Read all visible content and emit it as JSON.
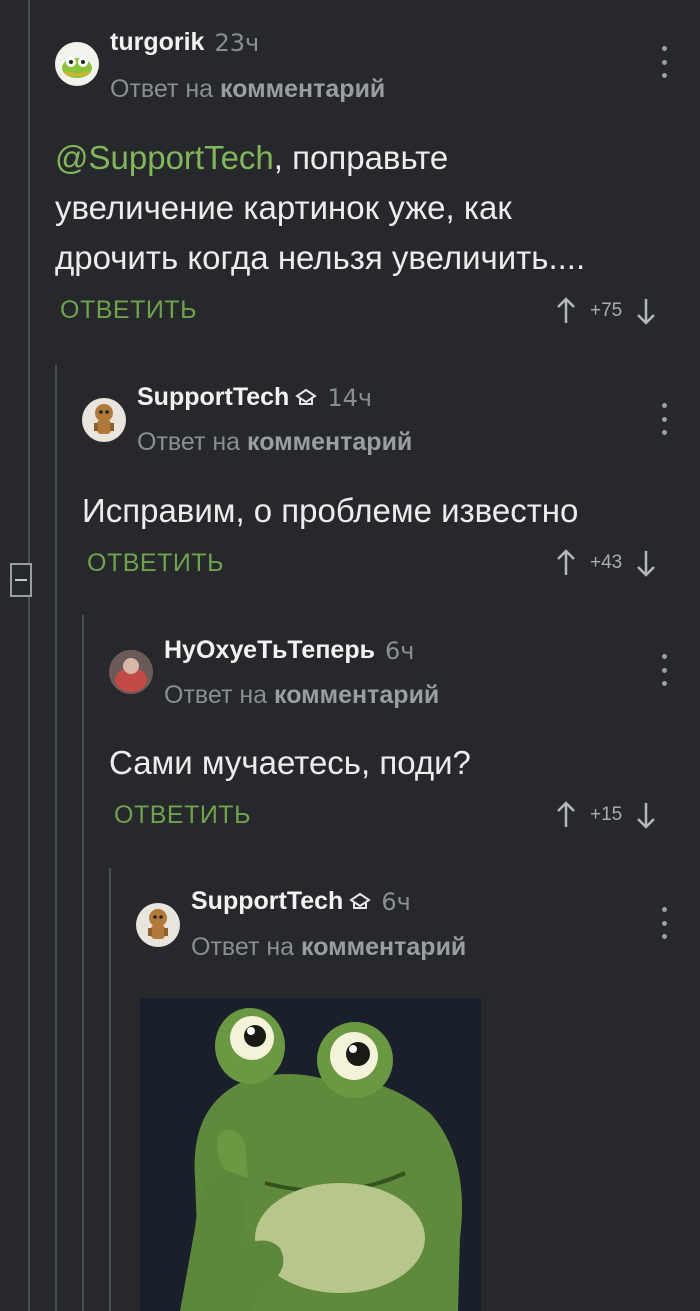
{
  "comments": [
    {
      "author": "turgorik",
      "time": "23ч",
      "reply_prefix": "Ответ на",
      "reply_link": "комментарий",
      "mention": "@SupportTech",
      "text_line1_rest": ", поправьте",
      "text_line2": "увеличение картинок уже, как",
      "text_line3": "дрочить когда нельзя увеличить....",
      "reply_label": "ОТВЕТИТЬ",
      "rating": "+75"
    },
    {
      "author": "SupportTech",
      "time": "14ч",
      "reply_prefix": "Ответ на",
      "reply_link": "комментарий",
      "text": "Исправим, о проблеме известно",
      "reply_label": "ОТВЕТИТЬ",
      "rating": "+43"
    },
    {
      "author": "НуОхуеТьТеперь",
      "time": "6ч",
      "reply_prefix": "Ответ на",
      "reply_link": "комментарий",
      "text": "Сами мучаетесь, поди?",
      "reply_label": "ОТВЕТИТЬ",
      "rating": "+15"
    },
    {
      "author": "SupportTech",
      "time": "6ч",
      "reply_prefix": "Ответ на",
      "reply_link": "комментарий"
    }
  ],
  "colors": {
    "background": "#26282b",
    "accent": "#6fa24d",
    "muted": "#8a8d91"
  }
}
